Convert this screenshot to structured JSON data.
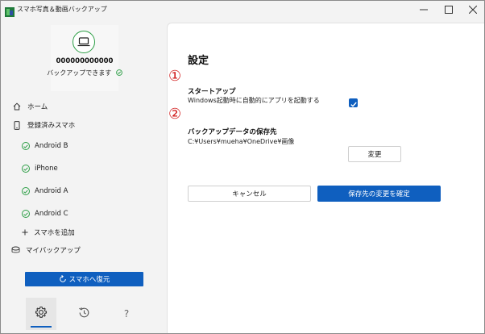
{
  "window": {
    "title": "スマホ写真＆動画バックアップ"
  },
  "sidebar": {
    "device": {
      "id": "000000000000",
      "status": "バックアップできます"
    },
    "nav": {
      "home": "ホーム",
      "registered": "登録済みスマホ",
      "add": "スマホを追加",
      "mybackup": "マイバックアップ"
    },
    "phones": [
      "Android B",
      "iPhone",
      "Android A",
      "Android C"
    ],
    "restore_button": "スマホへ復元"
  },
  "settings": {
    "title": "設定",
    "marker1": "①",
    "marker2": "②",
    "startup_heading": "スタートアップ",
    "startup_desc": "Windows起動時に自動的にアプリを起動する",
    "startup_checked": true,
    "save_heading": "バックアップデータの保存先",
    "save_path": "C:¥Users¥mueha¥OneDrive¥画像",
    "change_button": "変更",
    "cancel_button": "キャンセル",
    "confirm_button": "保存先の変更を確定"
  },
  "colors": {
    "accent": "#0f5fbf",
    "success": "#2c9e45",
    "marker": "#d11a1a"
  }
}
